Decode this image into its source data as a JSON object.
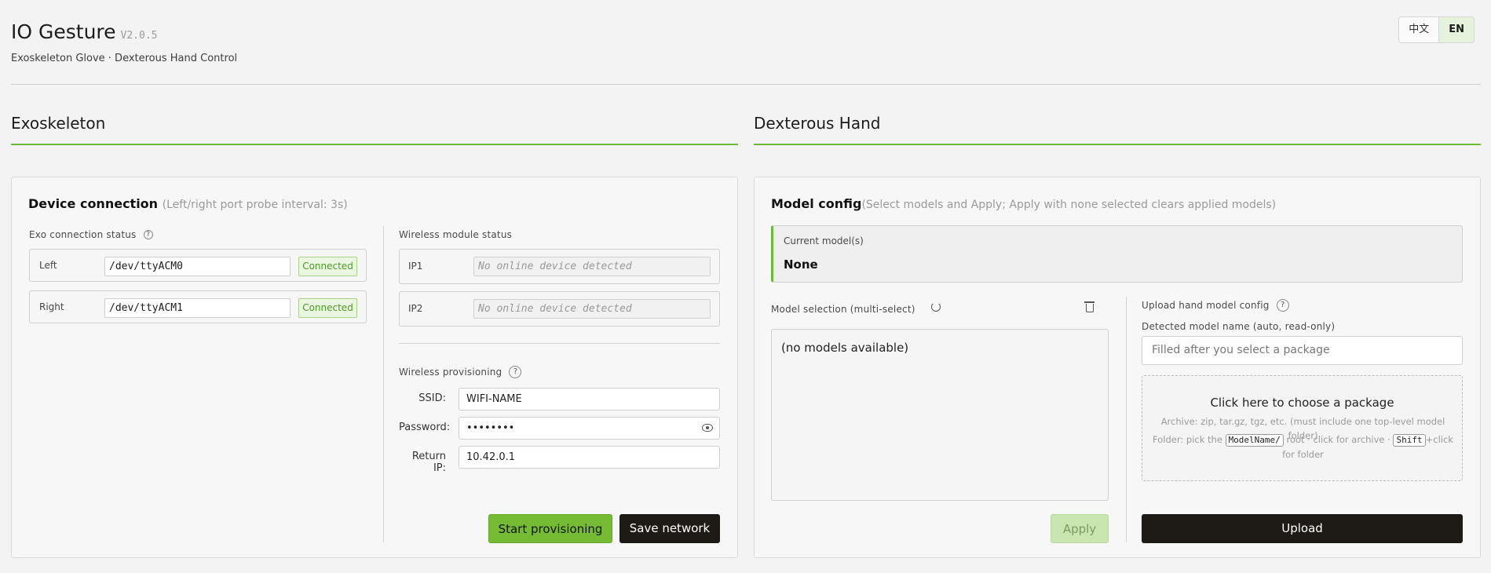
{
  "header": {
    "title": "IO Gesture",
    "version": "V2.0.5",
    "subtitle": "Exoskeleton Glove · Dexterous Hand Control",
    "lang_options": [
      "中文",
      "EN"
    ],
    "lang_selected": "EN"
  },
  "exo": {
    "section_title": "Exoskeleton",
    "panel_title": "Device connection",
    "panel_hint": "(Left/right port probe interval: 3s)",
    "conn_status_label": "Exo connection status",
    "ports": [
      {
        "side": "Left",
        "port": "/dev/ttyACM0",
        "status": "Connected"
      },
      {
        "side": "Right",
        "port": "/dev/ttyACM1",
        "status": "Connected"
      }
    ],
    "wireless_status_label": "Wireless module status",
    "ips": [
      {
        "name": "IP1",
        "placeholder": "No online device detected"
      },
      {
        "name": "IP2",
        "placeholder": "No online device detected"
      }
    ],
    "provisioning_label": "Wireless provisioning",
    "ssid_label": "SSID:",
    "ssid_value": "WIFI-NAME",
    "password_label": "Password:",
    "password_value": "••••••••",
    "return_ip_label": "Return IP:",
    "return_ip_value": "10.42.0.1",
    "start_btn": "Start provisioning",
    "save_btn": "Save network"
  },
  "hand": {
    "section_title": "Dexterous Hand",
    "panel_title": "Model config",
    "panel_hint": "(Select models and Apply; Apply with none selected clears applied models)",
    "current_label": "Current model(s)",
    "current_value": "None",
    "selection_label": "Model selection (multi-select)",
    "no_models": "(no models available)",
    "apply_btn": "Apply",
    "upload_label": "Upload hand model config",
    "detected_label": "Detected model name (auto, read-only)",
    "detected_placeholder": "Filled after you select a package",
    "dz_title": "Click here to choose a package",
    "dz_line1": "Archive: zip, tar.gz, tgz, etc. (must include one top-level model folder)",
    "dz_line2_a": "Folder: pick the",
    "dz_kbd1": "ModelName/",
    "dz_line2_b": "root · click for archive ·",
    "dz_kbd2": "Shift",
    "dz_line2_c": "+click",
    "dz_line3": "for folder",
    "upload_btn": "Upload"
  },
  "icons": {
    "help": "help-circle-icon",
    "refresh": "refresh-icon",
    "trash": "trash-icon",
    "eye": "eye-icon"
  },
  "colors": {
    "accent": "#76bb34",
    "dark_button": "#1e1a16",
    "connected_text": "#4c9b26"
  }
}
